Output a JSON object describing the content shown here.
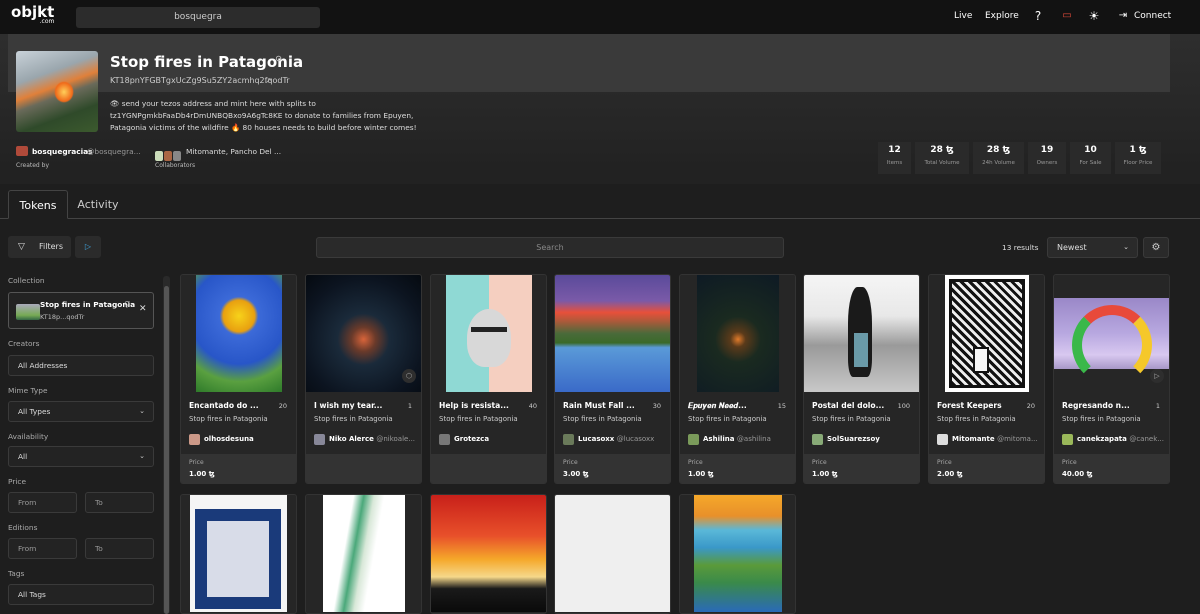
{
  "header": {
    "logo": "objkt",
    "logo_sub": ".com",
    "search_value": "bosquegra",
    "nav": {
      "live": "Live",
      "explore": "Explore",
      "connect": "Connect"
    }
  },
  "collection": {
    "title": "Stop fires in Patagonia",
    "contract": "KT18pnYFGBTgxUcZg9Su5ZY2acmhq2fqodTr",
    "description": "👁 send your tezos address and mint here with splits to tz1YGNPgmkbFaaDb4rDmUNBQBxo9A6gTc8KE to donate to families from Epuyen, Patagonia victims of the wildfire 🔥 80 houses needs to build before winter comes!",
    "creator_name": "bosquegracias",
    "creator_handle": "@bosquegra...",
    "created_by_label": "Created by",
    "collaborators": "Mitomante, Pancho Del ...",
    "collaborators_label": "Collaborators",
    "stats": [
      {
        "value": "12",
        "label": "Items"
      },
      {
        "value": "28 ꜩ",
        "label": "Total Volume"
      },
      {
        "value": "28 ꜩ",
        "label": "24h Volume"
      },
      {
        "value": "19",
        "label": "Owners"
      },
      {
        "value": "10",
        "label": "For Sale"
      },
      {
        "value": "1 ꜩ",
        "label": "Floor Price"
      }
    ]
  },
  "tabs": {
    "tokens": "Tokens",
    "activity": "Activity"
  },
  "toolbar": {
    "filters_label": "Filters",
    "search_placeholder": "Search",
    "results": "13 results",
    "sort_value": "Newest"
  },
  "sidebar": {
    "collection_label": "Collection",
    "collection_name": "Stop fires in Patagonia",
    "collection_short": "KT18p...qodTr",
    "creators_label": "Creators",
    "creators_value": "All Addresses",
    "mime_label": "Mime Type",
    "mime_value": "All Types",
    "availability_label": "Availability",
    "availability_value": "All",
    "price_label": "Price",
    "price_from": "From",
    "price_to": "To",
    "editions_label": "Editions",
    "editions_from": "From",
    "editions_to": "To",
    "tags_label": "Tags",
    "tags_value": "All Tags"
  },
  "price_label": "Price",
  "tokens": [
    {
      "title": "Encantado do ...",
      "editions": "20",
      "collection": "Stop fires in Patagonia",
      "artist": "olhosdesuna",
      "handle": "",
      "price": "1.00 ꜩ"
    },
    {
      "title": "I wish my tear...",
      "editions": "1",
      "collection": "Stop fires in Patagonia",
      "artist": "Niko Alerce",
      "handle": "@nikoale...",
      "price": ""
    },
    {
      "title": "Help is resista...",
      "editions": "40",
      "collection": "Stop fires in Patagonia",
      "artist": "Grotezca",
      "handle": "",
      "price": ""
    },
    {
      "title": "Rain Must Fall ...",
      "editions": "30",
      "collection": "Stop fires in Patagonia",
      "artist": "Lucasoxx",
      "handle": "@lucasoxx",
      "price": "3.00 ꜩ"
    },
    {
      "title": "𝑬𝒑𝒖𝒚𝒆𝒏 𝑵𝒆𝒆𝒅...",
      "editions": "15",
      "collection": "Stop fires in Patagonia",
      "artist": "Ashilina",
      "handle": "@ashilina",
      "price": "1.00 ꜩ"
    },
    {
      "title": "Postal del dolo...",
      "editions": "100",
      "collection": "Stop fires in Patagonia",
      "artist": "SolSuarezsoy",
      "handle": "",
      "price": "1.00 ꜩ"
    },
    {
      "title": "Forest Keepers",
      "editions": "20",
      "collection": "Stop fires in Patagonia",
      "artist": "Mitomante",
      "handle": "@mitoma...",
      "price": "2.00 ꜩ"
    },
    {
      "title": "Regresando n...",
      "editions": "1",
      "collection": "Stop fires in Patagonia",
      "artist": "canekzapata",
      "handle": "@canek...",
      "price": "40.00 ꜩ"
    }
  ]
}
